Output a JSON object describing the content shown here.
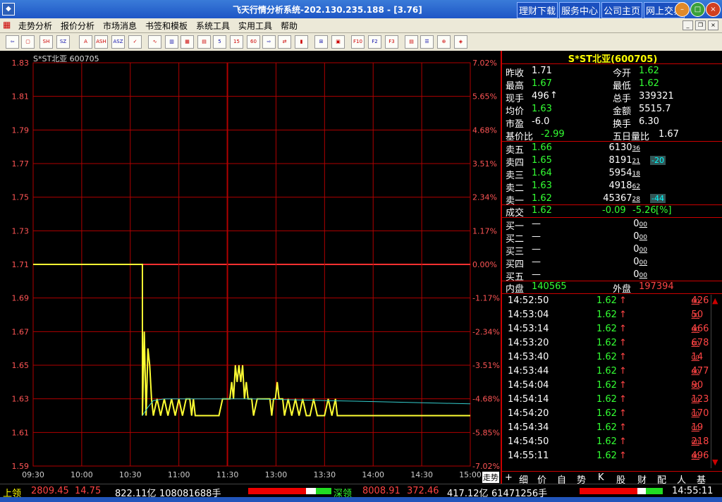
{
  "window": {
    "title": "飞天行情分析系统-202.130.235.188 - [3.76]",
    "app_icon": "app-icon",
    "links": [
      "理财下载",
      "服务中心",
      "公司主页",
      "网上交易"
    ]
  },
  "menu": [
    "走势分析",
    "报价分析",
    "市场消息",
    "书签和模板",
    "系统工具",
    "实用工具",
    "帮助"
  ],
  "toolbar_icons": [
    "back-icon",
    "window-icon",
    "sh-icon",
    "sz-icon",
    "a-icon",
    "ash-icon",
    "asz-icon",
    "check-icon",
    "line-chart-icon",
    "kline-day-icon",
    "kline-week-icon",
    "kline-month-icon",
    "kline-5min-icon",
    "kline-15min-icon",
    "kline-60min-icon",
    "arrow-right-icon",
    "swap-icon",
    "bar-icon",
    "grid-icon",
    "square-icon",
    "f10-icon",
    "f2-icon",
    "f3-icon",
    "book-icon",
    "list-icon",
    "zoom-icon",
    "palette-icon"
  ],
  "chart": {
    "stock_title": "S*ST北亚  600705",
    "price_labels": [
      "1.83",
      "1.81",
      "1.79",
      "1.77",
      "1.75",
      "1.73",
      "1.71",
      "1.69",
      "1.67",
      "1.65",
      "1.63",
      "1.61",
      "1.59"
    ],
    "pct_labels": [
      "7.02%",
      "5.65%",
      "4.68%",
      "3.51%",
      "2.34%",
      "1.17%",
      "0.00%",
      "-1.17%",
      "-2.34%",
      "-3.51%",
      "-4.68%",
      "-5.85%",
      "-7.02%"
    ],
    "time_labels": [
      "09:30",
      "10:00",
      "10:30",
      "11:00",
      "11:30",
      "13:00",
      "13:30",
      "14:00",
      "14:30",
      "15:00"
    ],
    "colors": {
      "price_line": "#ffff33",
      "avg_line": "#33cccc",
      "grid": "#b00000",
      "axis_text_left": "#ff5555",
      "axis_text_right": "#ff5555"
    }
  },
  "quote": {
    "title": "S*ST北亚(600705)",
    "zuoshou_label": "昨收",
    "zuoshou": "1.71",
    "jinkai_label": "今开",
    "jinkai": "1.62",
    "zuigao_label": "最高",
    "zuigao": "1.67",
    "zuidi_label": "最低",
    "zuidi": "1.62",
    "xianshou_label": "现手",
    "xianshou": "496",
    "zongshou_label": "总手",
    "zongshou": "339321",
    "junjia_label": "均价",
    "junjia": "1.63",
    "jine_label": "金额",
    "jine": "5515.7",
    "shiying_label": "市盈",
    "shiying": "-6.0",
    "huanshou_label": "换手",
    "huanshou": "6.30",
    "jijiabi_label": "基价比",
    "jijiabi": "-2.99",
    "wuriliangbi_label": "五日量比",
    "wuriliangbi": "1.67",
    "sells": [
      {
        "label": "卖五",
        "price": "1.66",
        "vol": "6130",
        "small": "36",
        "badge": ""
      },
      {
        "label": "卖四",
        "price": "1.65",
        "vol": "8191",
        "small": "21",
        "badge": "-20"
      },
      {
        "label": "卖三",
        "price": "1.64",
        "vol": "5954",
        "small": "18",
        "badge": ""
      },
      {
        "label": "卖二",
        "price": "1.63",
        "vol": "4918",
        "small": "62",
        "badge": ""
      },
      {
        "label": "卖一",
        "price": "1.62",
        "vol": "45367",
        "small": "28",
        "badge": "-44"
      }
    ],
    "chengjiao_label": "成交",
    "chengjiao": "1.62",
    "change": "-0.09",
    "change_pct": "-5.26",
    "pct_sign": "[%]",
    "buys": [
      {
        "label": "买一",
        "price": "—",
        "vol": "0",
        "small": "00"
      },
      {
        "label": "买二",
        "price": "—",
        "vol": "0",
        "small": "00"
      },
      {
        "label": "买三",
        "price": "—",
        "vol": "0",
        "small": "00"
      },
      {
        "label": "买四",
        "price": "—",
        "vol": "0",
        "small": "00"
      },
      {
        "label": "买五",
        "price": "—",
        "vol": "0",
        "small": "00"
      }
    ],
    "neipan_label": "内盘",
    "neipan": "140565",
    "waipan_label": "外盘",
    "waipan": "197394"
  },
  "ticks": [
    {
      "time": "14:52:50",
      "price": "1.62",
      "vol": "426",
      "small": "00"
    },
    {
      "time": "14:53:04",
      "price": "1.62",
      "vol": "50",
      "small": "00"
    },
    {
      "time": "14:53:14",
      "price": "1.62",
      "vol": "466",
      "small": "00"
    },
    {
      "time": "14:53:20",
      "price": "1.62",
      "vol": "678",
      "small": "00"
    },
    {
      "time": "14:53:40",
      "price": "1.62",
      "vol": "14",
      "small": "00"
    },
    {
      "time": "14:53:44",
      "price": "1.62",
      "vol": "477",
      "small": "00"
    },
    {
      "time": "14:54:04",
      "price": "1.62",
      "vol": "90",
      "small": "00"
    },
    {
      "time": "14:54:14",
      "price": "1.62",
      "vol": "123",
      "small": "00"
    },
    {
      "time": "14:54:20",
      "price": "1.62",
      "vol": "170",
      "small": "00"
    },
    {
      "time": "14:54:34",
      "price": "1.62",
      "vol": "19",
      "small": "00"
    },
    {
      "time": "14:54:50",
      "price": "1.62",
      "vol": "218",
      "small": "00"
    },
    {
      "time": "14:55:11",
      "price": "1.62",
      "vol": "496",
      "small": "00"
    }
  ],
  "tabs": [
    "+",
    "细",
    "价",
    "自",
    "势",
    "K",
    "股",
    "财",
    "配",
    "人",
    "基"
  ],
  "tab_zoushi": "走势",
  "status": {
    "sh_label": "上领",
    "sh_index": "2809.45",
    "sh_change": "14.75",
    "sh_amount": "822.11亿",
    "sh_volume": "108081688手",
    "sz_label": "深领",
    "sz_index": "8008.91",
    "sz_change": "372.46",
    "sz_amount": "417.12亿",
    "sz_volume": "61471256手",
    "clock": "14:55:11"
  }
}
